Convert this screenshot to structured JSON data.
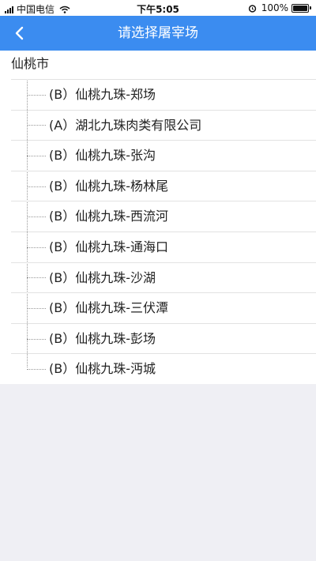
{
  "status_bar": {
    "carrier": "中国电信",
    "time": "下午5:05",
    "battery": "100%",
    "battery_level": 1.0,
    "icons": [
      "signal-icon",
      "wifi-icon",
      "alarm-icon",
      "battery-icon"
    ]
  },
  "header": {
    "title": "请选择屠宰场",
    "back_icon": "chevron-left-icon",
    "color": "#3b8cf0"
  },
  "tree": {
    "root_label": "仙桃市",
    "items": [
      {
        "label": "(B）仙桃九珠-郑场"
      },
      {
        "label": "(A）湖北九珠肉类有限公司"
      },
      {
        "label": "(B）仙桃九珠-张沟"
      },
      {
        "label": "(B）仙桃九珠-杨林尾"
      },
      {
        "label": "(B）仙桃九珠-西流河"
      },
      {
        "label": "(B）仙桃九珠-通海口"
      },
      {
        "label": "(B）仙桃九珠-沙湖"
      },
      {
        "label": "(B）仙桃九珠-三伏潭"
      },
      {
        "label": "(B）仙桃九珠-彭场"
      },
      {
        "label": "(B）仙桃九珠-沔城"
      }
    ]
  }
}
